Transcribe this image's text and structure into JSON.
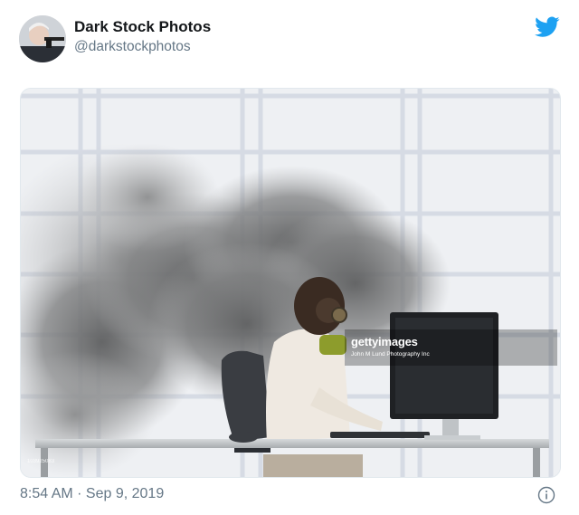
{
  "tweet": {
    "display_name": "Dark Stock Photos",
    "handle": "@darkstockphotos",
    "timestamp": "8:54 AM · Sep 9, 2019",
    "brand_color": "#1da1f2",
    "icons": {
      "brand": "twitter-bird-icon",
      "info": "info-icon"
    }
  },
  "media": {
    "watermark_brand": "gettyimages",
    "watermark_credit": "John M Lund Photography Inc",
    "image_id": "103925083"
  }
}
